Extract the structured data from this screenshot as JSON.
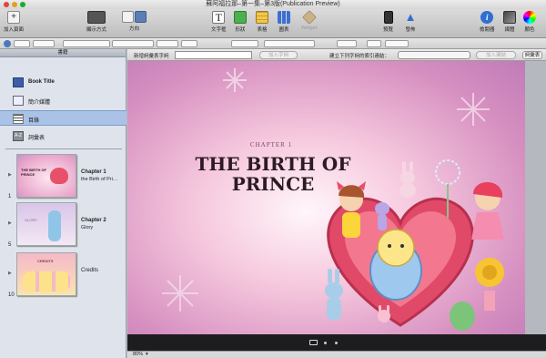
{
  "window": {
    "title": "蘇阿福拉那–第一集–第3版(Publication Preview)"
  },
  "toolbar": {
    "add_page": "加入頁面",
    "view_mode": "顯示方式",
    "orientation": "方向",
    "text_box": "文字框",
    "shapes": "形狀",
    "table": "表格",
    "chart": "圖表",
    "widget": "Widget",
    "preview": "預覽",
    "publish": "發佈",
    "inspector": "檢閱器",
    "media": "媒體",
    "colors": "顏色"
  },
  "glossary_bar": {
    "new_term_label": "新增詞彙表字詞",
    "add_term_button": "加入字詞",
    "link_label": "建立下列字詞的索引連結：",
    "add_link_button": "加入連結",
    "glossary_button": "詞彙表"
  },
  "sidebar": {
    "header": "書籍",
    "items": [
      {
        "label": "Book Title"
      },
      {
        "label": "簡介媒體"
      },
      {
        "label": "目錄"
      },
      {
        "label": "詞彙表"
      }
    ],
    "chapters": [
      {
        "number": "1",
        "title": "Chapter 1",
        "subtitle": "the Birth of Pri…",
        "thumb_text": "THE BIRTH OF PRINCE"
      },
      {
        "number": "5",
        "title": "Chapter 2",
        "subtitle": "Glory",
        "thumb_text": "GLORY"
      },
      {
        "number": "10",
        "title": "Credits",
        "subtitle": "",
        "thumb_text": "CREDITS"
      }
    ]
  },
  "page": {
    "chapter_label": "CHAPTER 1",
    "title_line1": "THE BIRTH OF",
    "title_line2": "PRINCE"
  },
  "status": {
    "zoom": "80%"
  },
  "colors": {
    "selection": "#a9c2e6",
    "page_pink": "#f6c9de",
    "page_purple": "#c07ab8",
    "title_text": "#2d1b24"
  }
}
